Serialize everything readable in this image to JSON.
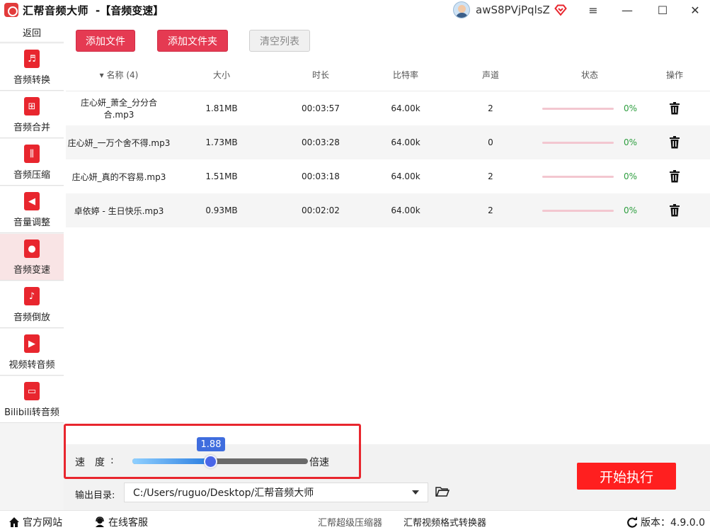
{
  "window": {
    "app_name": "汇帮音频大师",
    "title": "-【音频变速】",
    "username": "awS8PVjPqlsZ",
    "min_glyph": "—",
    "menu_glyph": "≡",
    "max_glyph": "☐",
    "close_glyph": "✕"
  },
  "sidebar": {
    "back": "返回",
    "items": [
      {
        "label": "音频转换",
        "icon": "audio-convert-icon",
        "glyph": "♬"
      },
      {
        "label": "音频合并",
        "icon": "audio-merge-icon",
        "glyph": "⊞"
      },
      {
        "label": "音频压缩",
        "icon": "audio-compress-icon",
        "glyph": "⫼"
      },
      {
        "label": "音量调整",
        "icon": "volume-icon",
        "glyph": "◀"
      },
      {
        "label": "音频变速",
        "icon": "microphone-icon",
        "glyph": "●"
      },
      {
        "label": "音频倒放",
        "icon": "music-note-icon",
        "glyph": "♪"
      },
      {
        "label": "视频转音频",
        "icon": "film-icon",
        "glyph": "▶"
      },
      {
        "label": "Bilibili转音频",
        "icon": "tv-icon",
        "glyph": "▭"
      }
    ]
  },
  "toolbar": {
    "add_file": "添加文件",
    "add_folder": "添加文件夹",
    "clear_list": "清空列表"
  },
  "table": {
    "headers": {
      "name": "▾ 名称 (4)",
      "size": "大小",
      "duration": "时长",
      "bitrate": "比特率",
      "channels": "声道",
      "status": "状态",
      "action": "操作"
    },
    "rows": [
      {
        "name": "庄心妍_萧全_分分合合.mp3",
        "size": "1.81MB",
        "duration": "00:03:57",
        "bitrate": "64.00k",
        "channels": "2",
        "progress": "0%"
      },
      {
        "name": "庄心妍_一万个舍不得.mp3",
        "size": "1.73MB",
        "duration": "00:03:28",
        "bitrate": "64.00k",
        "channels": "0",
        "progress": "0%"
      },
      {
        "name": "庄心妍_真的不容易.mp3",
        "size": "1.51MB",
        "duration": "00:03:18",
        "bitrate": "64.00k",
        "channels": "2",
        "progress": "0%"
      },
      {
        "name": "卓依婷 - 生日快乐.mp3",
        "size": "0.93MB",
        "duration": "00:02:02",
        "bitrate": "64.00k",
        "channels": "2",
        "progress": "0%"
      }
    ]
  },
  "speed": {
    "label": "速度",
    "colon": ":",
    "value": "1.88",
    "value_fraction": 0.44,
    "unit": "倍速"
  },
  "output": {
    "label": "输出目录:",
    "path": "C:/Users/ruguo/Desktop/汇帮音频大师"
  },
  "start_button": "开始执行",
  "footer": {
    "website": "官方网站",
    "service": "在线客服",
    "compressor": "汇帮超级压缩器",
    "video_converter": "汇帮视频格式转换器",
    "version": "版本：4.9.0.0"
  },
  "colors": {
    "accent": "#e53a52",
    "start": "#ff1f1f",
    "progress_text": "#2e9e3f",
    "slider_thumb": "#4a66e8"
  }
}
